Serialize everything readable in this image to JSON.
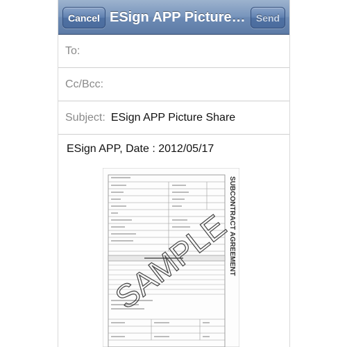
{
  "nav": {
    "cancel_label": "Cancel",
    "title": "ESign APP Picture Share",
    "send_label": "Send"
  },
  "fields": {
    "to_label": "To:",
    "to_value": "",
    "cc_label": "Cc/Bcc:",
    "cc_value": "",
    "subject_label": "Subject:",
    "subject_value": "ESign APP Picture Share"
  },
  "body": {
    "text": "ESign APP, Date : 2012/05/17"
  },
  "attachment": {
    "doc_title": "SUBCONTRACT AGREEMENT",
    "watermark": "SAMPLE"
  },
  "colors": {
    "nav_bar": "#6c8ab4",
    "button_border": "#34507e",
    "label_gray": "#8a8a8a"
  }
}
